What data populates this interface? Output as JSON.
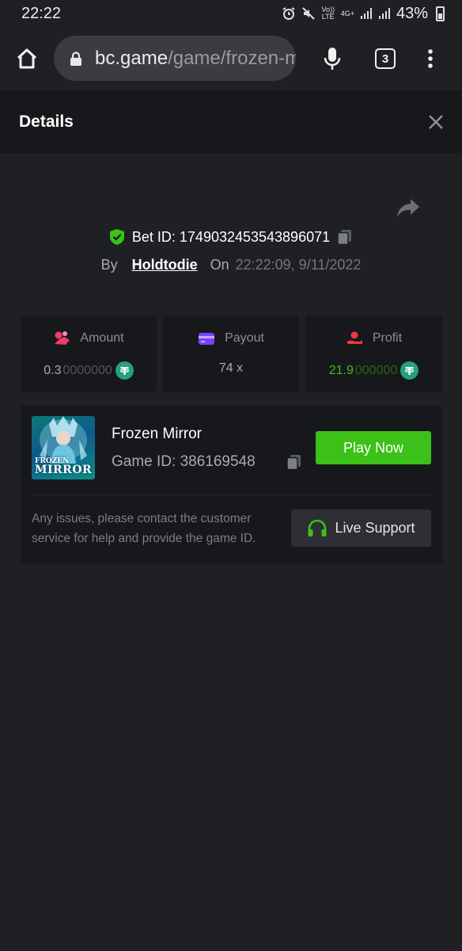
{
  "status_bar": {
    "time": "22:22",
    "network_volte": "Vo)) LTE",
    "network_type": "4G+",
    "battery": "43%"
  },
  "browser": {
    "url_host": "bc.game",
    "url_path": "/game/frozen-mirror",
    "tab_count": "3"
  },
  "details": {
    "title": "Details"
  },
  "bet": {
    "id_label": "Bet ID:",
    "id_value": "1749032453543896071",
    "by_label": "By",
    "user": "Holdtodie",
    "on_label": "On",
    "datetime": "22:22:09, 9/11/2022"
  },
  "stats": {
    "amount": {
      "label": "Amount",
      "value_strong": "0.3",
      "value_dim": "0000000",
      "icon": "amount-icon"
    },
    "payout": {
      "label": "Payout",
      "value": "74 x",
      "icon": "card-icon"
    },
    "profit": {
      "label": "Profit",
      "value_strong": "21.9",
      "value_dim": "000000",
      "icon": "profit-icon"
    }
  },
  "game": {
    "thumb_line1": "FROZEN",
    "thumb_line2": "MIRROR",
    "name": "Frozen Mirror",
    "id_label": "Game ID:",
    "id_value": "386169548",
    "play_label": "Play Now",
    "issues_text": "Any issues, please contact the customer service for help and provide the game ID.",
    "support_label": "Live Support"
  },
  "colors": {
    "accent_green": "#3bc117",
    "background": "#1f2024",
    "card": "#17181b",
    "token": "#26a17b"
  }
}
